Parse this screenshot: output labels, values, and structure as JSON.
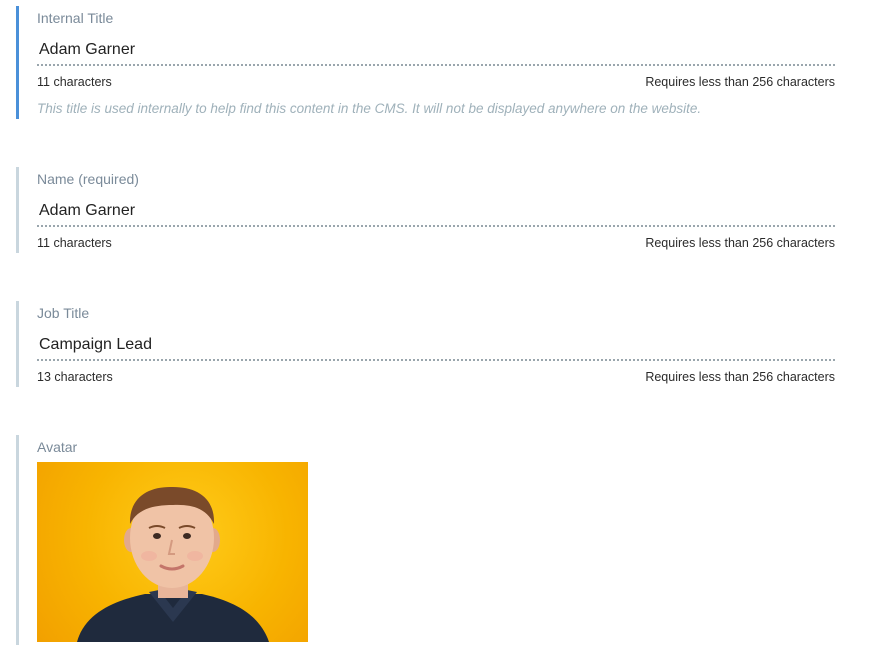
{
  "fields": {
    "internal_title": {
      "label": "Internal Title",
      "value": "Adam Garner",
      "char_count": "11 characters",
      "limit": "Requires less than 256 characters",
      "help": "This title is used internally to help find this content in the CMS. It will not be displayed anywhere on the website."
    },
    "name": {
      "label": "Name (required)",
      "value": "Adam Garner",
      "char_count": "11 characters",
      "limit": "Requires less than 256 characters"
    },
    "job_title": {
      "label": "Job Title",
      "value": "Campaign Lead",
      "char_count": "13 characters",
      "limit": "Requires less than 256 characters"
    },
    "avatar": {
      "label": "Avatar",
      "image_icon": "person-portrait"
    }
  },
  "colors": {
    "active_accent": "#4a90d9",
    "inactive_accent": "#c9d6de",
    "avatar_background": "#f8b400"
  }
}
